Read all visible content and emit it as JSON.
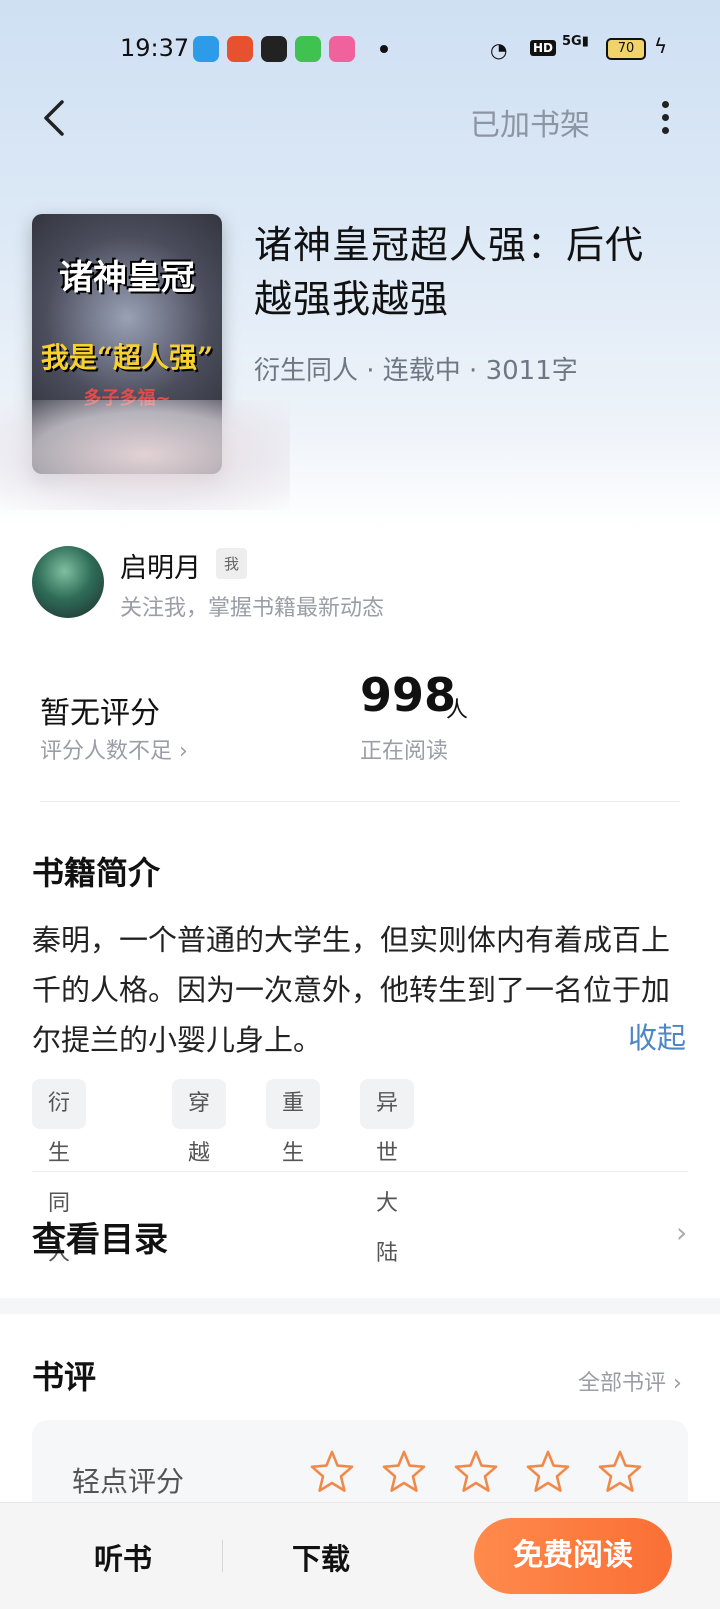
{
  "status_bar": {
    "time": "19:37",
    "battery": "70",
    "signal": "5G",
    "hd": "HD"
  },
  "header": {
    "shelf_label": "已加书架"
  },
  "cover": {
    "line1": "诸神皇冠",
    "line2": "我是“超人强”",
    "line3": "多子多福~"
  },
  "book": {
    "title": "诸神皇冠超人强：后代越强我越强",
    "meta": "衍生同人 · 连载中 · 3011字"
  },
  "author": {
    "name": "启明月",
    "tag": "我",
    "subtitle": "关注我，掌握书籍最新动态"
  },
  "stats": {
    "score_label": "暂无评分",
    "score_sub": "评分人数不足",
    "readers": "998",
    "readers_unit": "人",
    "readers_sub": "正在阅读"
  },
  "intro": {
    "heading": "书籍简介",
    "text": "秦明，一个普通的大学生，但实则体内有着成百上千的人格。因为一次意外，他转生到了一名位于加尔提兰的小婴儿身上。",
    "collapse": "收起",
    "tags": [
      "衍生同人",
      "穿越",
      "重生",
      "异世大陆"
    ]
  },
  "toc": {
    "label": "查看目录"
  },
  "reviews": {
    "heading": "书评",
    "all_label": "全部书评",
    "rate_label": "轻点评分",
    "star_color": "#f08a4b",
    "star_count": 5,
    "current_rating": 0
  },
  "bottom_bar": {
    "listen": "听书",
    "download": "下载",
    "read": "免费阅读",
    "read_color": "#fa6f35"
  },
  "colors": {
    "accent_link": "#4d86c4",
    "muted": "#9a9ea6"
  }
}
